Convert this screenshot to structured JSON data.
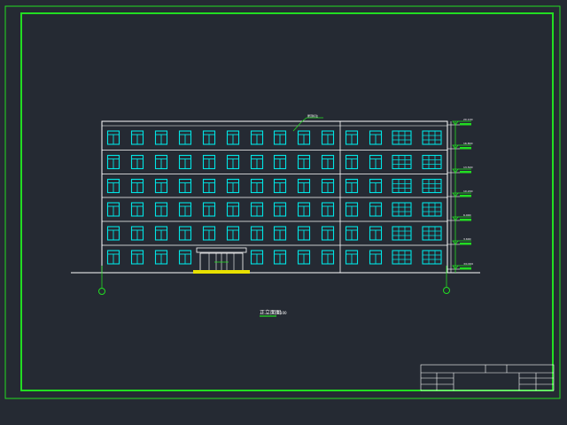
{
  "title_caption": "正立面图",
  "title_scale": "1:100",
  "roof_note": "屋顶标注",
  "axis_labels": [
    "",
    ""
  ],
  "levels": [
    "20.100",
    "16.800",
    "13.500",
    "10.200",
    "6.900",
    "3.600",
    "±0.000"
  ],
  "colors": {
    "background": "#252a33",
    "frame": "#22dd22",
    "building": "#ffffff",
    "window": "#00e5e5",
    "entrance": "#e8e000",
    "annotation": "#22dd22"
  }
}
